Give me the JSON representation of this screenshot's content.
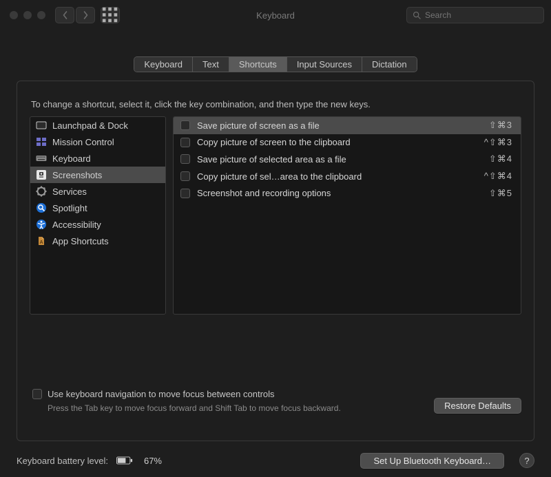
{
  "window": {
    "title": "Keyboard"
  },
  "search": {
    "placeholder": "Search"
  },
  "tabs": [
    {
      "label": "Keyboard",
      "active": false
    },
    {
      "label": "Text",
      "active": false
    },
    {
      "label": "Shortcuts",
      "active": true
    },
    {
      "label": "Input Sources",
      "active": false
    },
    {
      "label": "Dictation",
      "active": false
    }
  ],
  "instruction": "To change a shortcut, select it, click the key combination, and then type the new keys.",
  "categories": [
    {
      "label": "Launchpad & Dock",
      "icon": "launchpad",
      "selected": false
    },
    {
      "label": "Mission Control",
      "icon": "mission-control",
      "selected": false
    },
    {
      "label": "Keyboard",
      "icon": "keyboard",
      "selected": false
    },
    {
      "label": "Screenshots",
      "icon": "screenshots",
      "selected": true
    },
    {
      "label": "Services",
      "icon": "services",
      "selected": false
    },
    {
      "label": "Spotlight",
      "icon": "spotlight",
      "selected": false
    },
    {
      "label": "Accessibility",
      "icon": "accessibility",
      "selected": false
    },
    {
      "label": "App Shortcuts",
      "icon": "app-shortcuts",
      "selected": false
    }
  ],
  "shortcuts": [
    {
      "label": "Save picture of screen as a file",
      "keys": "⇧⌘3",
      "checked": false,
      "selected": true
    },
    {
      "label": "Copy picture of screen to the clipboard",
      "keys": "^⇧⌘3",
      "checked": false,
      "selected": false
    },
    {
      "label": "Save picture of selected area as a file",
      "keys": "⇧⌘4",
      "checked": false,
      "selected": false
    },
    {
      "label": "Copy picture of sel…area to the clipboard",
      "keys": "^⇧⌘4",
      "checked": false,
      "selected": false
    },
    {
      "label": "Screenshot and recording options",
      "keys": "⇧⌘5",
      "checked": false,
      "selected": false
    }
  ],
  "restore_defaults": "Restore Defaults",
  "keyboard_nav": {
    "label": "Use keyboard navigation to move focus between controls",
    "help": "Press the Tab key to move focus forward and Shift Tab to move focus backward.",
    "checked": false
  },
  "footer": {
    "battery_label": "Keyboard battery level:",
    "battery_pct": "67%",
    "bluetooth_button": "Set Up Bluetooth Keyboard…",
    "help": "?"
  }
}
